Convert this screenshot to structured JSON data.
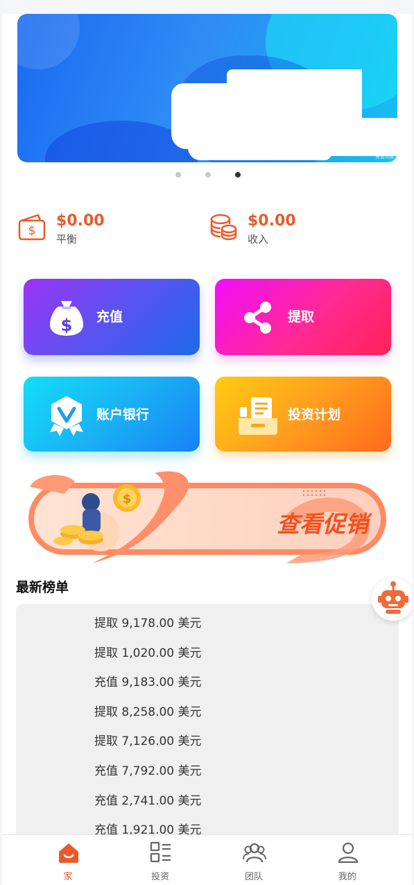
{
  "banner": {
    "corner_text": "安吉贷款",
    "slides": 3,
    "active_slide": 3
  },
  "balance": {
    "balance_value": "$0.00",
    "balance_label": "平衡",
    "income_value": "$0.00",
    "income_label": "收入"
  },
  "actions": {
    "recharge": "充值",
    "withdraw": "提取",
    "bank": "账户银行",
    "plan": "投资计划"
  },
  "promo": {
    "label": "查看促销"
  },
  "ranking": {
    "title": "最新榜单",
    "rows": [
      "提取 9,178.00 美元",
      "提取 1,020.00 美元",
      "充值 9,183.00 美元",
      "提取 8,258.00 美元",
      "提取 7,126.00 美元",
      "充值 7,792.00 美元",
      "充值 2,741.00 美元",
      "充值 1,921.00 美元"
    ]
  },
  "nav": {
    "items": [
      {
        "label": "家",
        "icon": "home-icon",
        "active": true
      },
      {
        "label": "投资",
        "icon": "invest-icon",
        "active": false
      },
      {
        "label": "团队",
        "icon": "team-icon",
        "active": false
      },
      {
        "label": "我的",
        "icon": "profile-icon",
        "active": false
      }
    ]
  },
  "colors": {
    "accent": "#ea5a28",
    "banner_blue": "#2f8cf5"
  }
}
